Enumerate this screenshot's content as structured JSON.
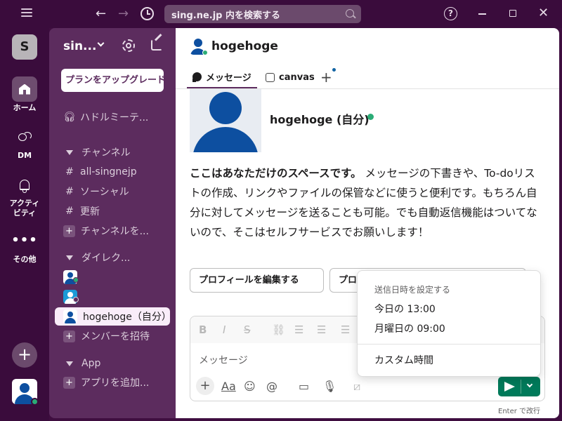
{
  "titlebar": {
    "search_text": "sing.ne.jp 内を検索する"
  },
  "rail": {
    "workspace_initial": "S",
    "items": [
      {
        "label": "ホーム"
      },
      {
        "label": "DM"
      },
      {
        "label": "アクティ\nビティ"
      },
      {
        "label": "その他"
      }
    ]
  },
  "sidebar": {
    "workspace_name": "sin...",
    "upgrade_label": "プランをアップグレード",
    "huddles_label": "ハドルミーテ...",
    "channels_header": "チャンネル",
    "channels": [
      "all-singnejp",
      "ソーシャル",
      "更新"
    ],
    "add_channel_label": "チャンネルを...",
    "dm_header": "ダイレク...",
    "dm_self_label": "hogehoge（自分）",
    "invite_label": "メンバーを招待",
    "app_header": "App",
    "add_app_label": "アプリを追加..."
  },
  "main": {
    "channel_name": "hogehoge",
    "tabs": [
      {
        "label": "メッセージ"
      },
      {
        "label": "canvas"
      }
    ],
    "profile_name": "hogehoge (自分)",
    "intro_bold": "ここはあなただけのスペースです。",
    "intro_text": " メッセージの下書きや、To-doリストの作成、リンクやファイルの保管などに使うと便利です。もちろん自分に対してメッセージを送ることも可能。でも自動返信機能はついてないので、そこはセルフサービスでお願いします！",
    "edit_profile_button": "プロフィールを編集する",
    "second_button": "プロ",
    "composer_placeholder": "メッセージ",
    "enter_hint": "Enter で改行"
  },
  "schedule_menu": {
    "title": "送信日時を設定する",
    "options": [
      "今日の 13:00",
      "月曜日の 09:00"
    ],
    "custom": "カスタム時間"
  },
  "colors": {
    "sidebar_bg": "#5c2c5e",
    "rail_bg": "#3a0c3c",
    "accent_green": "#007a5a",
    "status_green": "#2bac76",
    "avatar_blue": "#0d4fa0"
  }
}
